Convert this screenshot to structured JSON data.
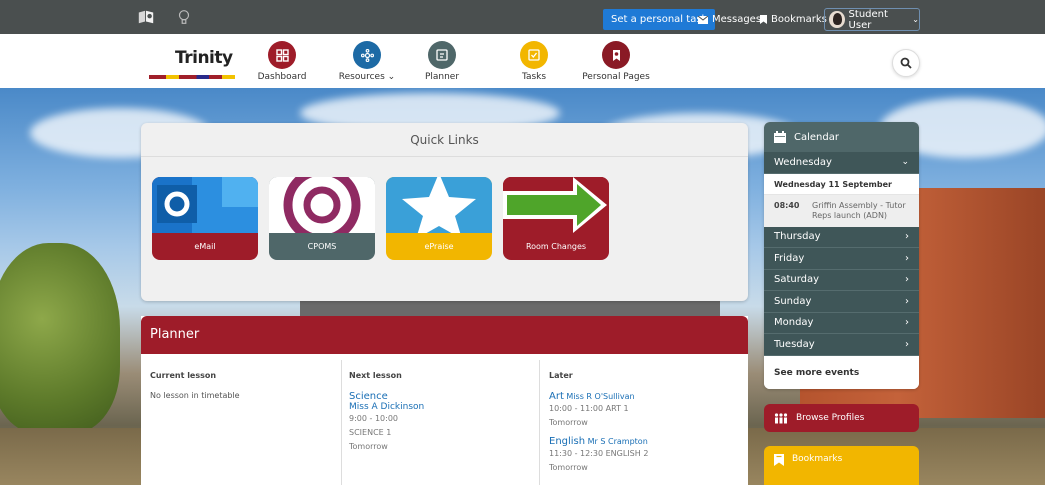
{
  "topbar": {
    "personal_task_label": "Set a personal task",
    "messages_label": "Messages",
    "bookmarks_label": "Bookmarks",
    "user_name": "Student User"
  },
  "logo": {
    "text": "Trinity"
  },
  "nav": {
    "items": [
      {
        "label": "Dashboard",
        "icon": "grid-icon",
        "color": "#9e1c29"
      },
      {
        "label": "Resources",
        "icon": "network-icon",
        "color": "#1d6aa5"
      },
      {
        "label": "Planner",
        "icon": "planner-icon",
        "color": "#4f6769"
      },
      {
        "label": "Tasks",
        "icon": "checkbox-icon",
        "color": "#f2b600"
      },
      {
        "label": "Personal Pages",
        "icon": "badge-icon",
        "color": "#8a1a25"
      }
    ]
  },
  "quick_links": {
    "title": "Quick Links",
    "tiles": [
      {
        "label": "eMail",
        "color": "#9e1c29"
      },
      {
        "label": "CPOMS",
        "color": "#4f6769"
      },
      {
        "label": "ePraise",
        "color": "#f2b600"
      },
      {
        "label": "Room Changes",
        "color": "#9e1c29"
      }
    ]
  },
  "planner": {
    "title": "Planner",
    "current": {
      "heading": "Current lesson",
      "text": "No lesson in timetable"
    },
    "next": {
      "heading": "Next lesson",
      "subject": "Science",
      "teacher": "Miss A Dickinson",
      "time": "9:00 - 10:00",
      "room": "SCIENCE 1",
      "day": "Tomorrow"
    },
    "later": {
      "heading": "Later",
      "items": [
        {
          "subject": "Art",
          "teacher": "Miss R O'Sullivan",
          "time_room": "10:00 - 11:00 ART 1",
          "day": "Tomorrow"
        },
        {
          "subject": "English",
          "teacher": "Mr S Crampton",
          "time_room": "11:30 - 12:30 ENGLISH 2",
          "day": "Tomorrow"
        }
      ]
    }
  },
  "calendar": {
    "title": "Calendar",
    "open_day": "Wednesday",
    "date_heading": "Wednesday 11 September",
    "event": {
      "time": "08:40",
      "description": "Griffin Assembly - Tutor Reps launch (ADN)"
    },
    "days": [
      "Thursday",
      "Friday",
      "Saturday",
      "Sunday",
      "Monday",
      "Tuesday"
    ],
    "see_more": "See more events"
  },
  "browse_profiles": {
    "label": "Browse Profiles"
  },
  "bookmarks_panel": {
    "label": "Bookmarks"
  }
}
